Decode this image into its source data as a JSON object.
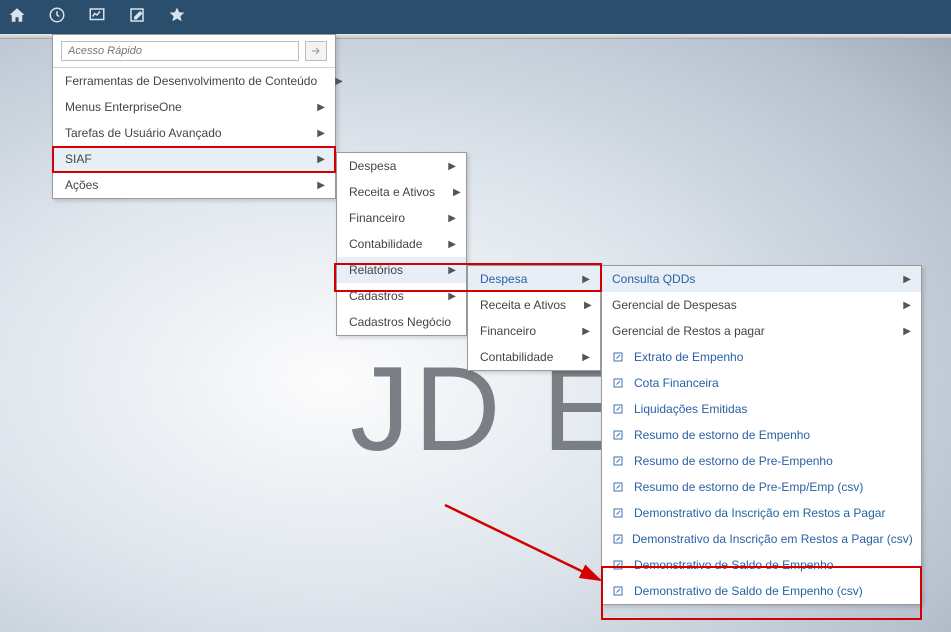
{
  "toolbar": {
    "icons": [
      "home",
      "clock",
      "chart",
      "edit",
      "star"
    ]
  },
  "quick_access": {
    "placeholder": "Acesso Rápido"
  },
  "menu1": {
    "items": [
      {
        "label": "Ferramentas de Desenvolvimento de Conteúdo",
        "arrow": true
      },
      {
        "label": "Menus EnterpriseOne",
        "arrow": true
      },
      {
        "label": "Tarefas de Usuário Avançado",
        "arrow": true
      },
      {
        "label": "SIAF",
        "arrow": true,
        "highlight": true
      },
      {
        "label": "Ações",
        "arrow": true
      }
    ]
  },
  "menu2": {
    "items": [
      {
        "label": "Despesa",
        "arrow": true
      },
      {
        "label": "Receita e Ativos",
        "arrow": true
      },
      {
        "label": "Financeiro",
        "arrow": true
      },
      {
        "label": "Contabilidade",
        "arrow": true
      },
      {
        "label": "Relatórios",
        "arrow": true,
        "highlight": true
      },
      {
        "label": "Cadastros",
        "arrow": true
      },
      {
        "label": "Cadastros Negócio",
        "arrow": true
      }
    ]
  },
  "menu3": {
    "items": [
      {
        "label": "Despesa",
        "arrow": true,
        "highlight": true
      },
      {
        "label": "Receita e Ativos",
        "arrow": true
      },
      {
        "label": "Financeiro",
        "arrow": true
      },
      {
        "label": "Contabilidade",
        "arrow": true
      }
    ]
  },
  "menu4": {
    "items": [
      {
        "label": "Consulta QDDs",
        "arrow": true
      },
      {
        "label": "Gerencial de Despesas",
        "arrow": true
      },
      {
        "label": "Gerencial de Restos a pagar",
        "arrow": true
      },
      {
        "label": "Extrato de Empenho",
        "doc": true
      },
      {
        "label": "Cota Financeira",
        "doc": true
      },
      {
        "label": "Liquidações Emitidas",
        "doc": true
      },
      {
        "label": "Resumo de estorno de Empenho",
        "doc": true
      },
      {
        "label": "Resumo de estorno de Pre-Empenho",
        "doc": true
      },
      {
        "label": "Resumo de estorno de Pre-Emp/Emp (csv)",
        "doc": true
      },
      {
        "label": "Demonstrativo da Inscrição em Restos a Pagar",
        "doc": true
      },
      {
        "label": "Demonstrativo da Inscrição em Restos a Pagar (csv)",
        "doc": true
      },
      {
        "label": "Demonstrativo de Saldo de Empenho",
        "doc": true,
        "highlight": true
      },
      {
        "label": "Demonstrativo de Saldo de Empenho (csv)",
        "doc": true,
        "highlight": true
      }
    ]
  },
  "bg_logo": "JD  ED"
}
